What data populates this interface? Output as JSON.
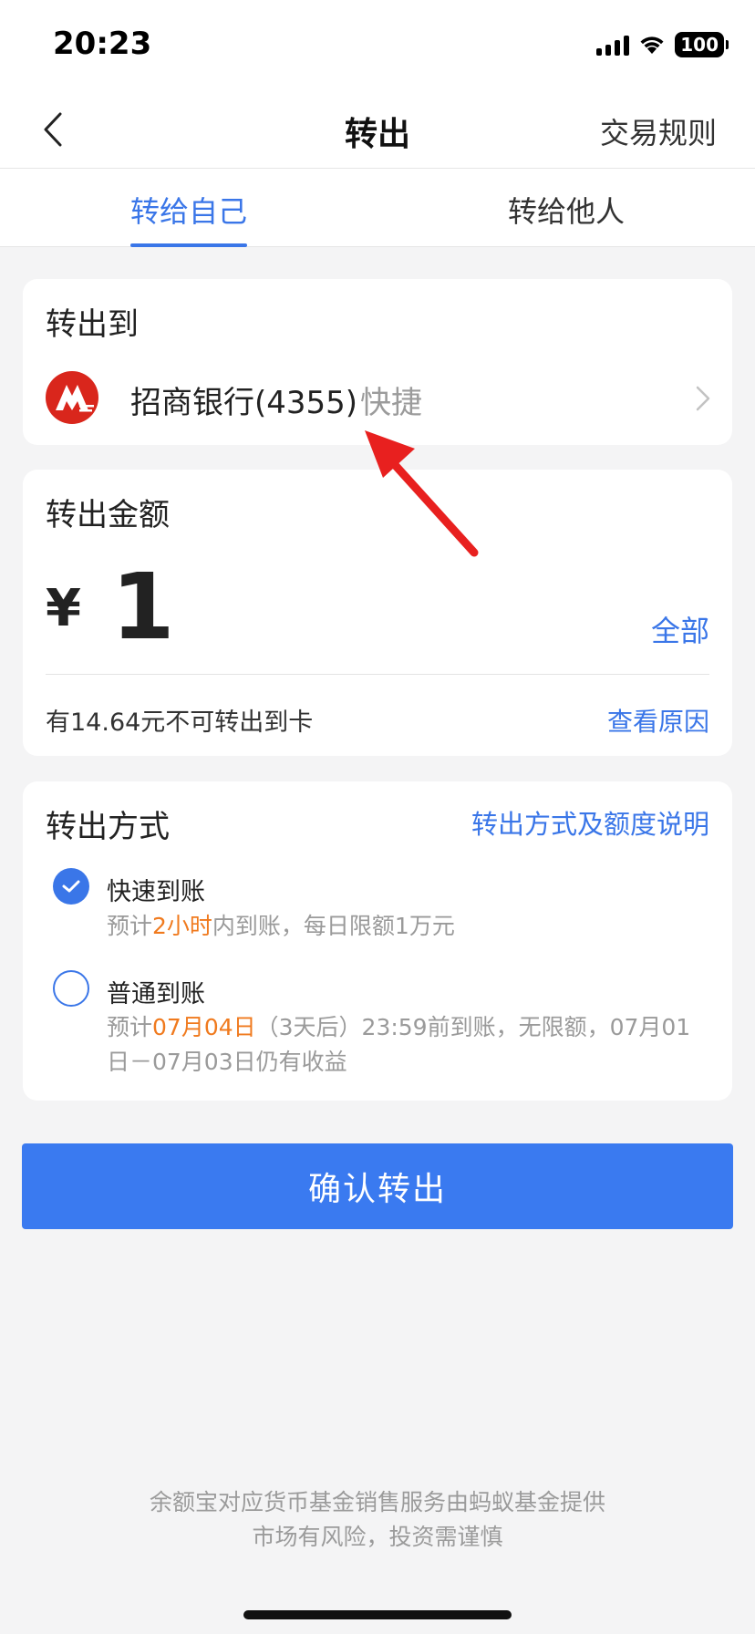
{
  "status_bar": {
    "time": "20:23",
    "battery": "100"
  },
  "nav": {
    "title": "转出",
    "rules_label": "交易规则"
  },
  "tabs": [
    {
      "label": "转给自己",
      "active": true
    },
    {
      "label": "转给他人",
      "active": false
    }
  ],
  "destination": {
    "title": "转出到",
    "bank_name": "招商银行(4355)",
    "bank_tag": "快捷"
  },
  "amount": {
    "title": "转出金额",
    "currency": "¥",
    "value": "1",
    "all_label": "全部",
    "note": "有14.64元不可转出到卡",
    "reason_label": "查看原因"
  },
  "method": {
    "title": "转出方式",
    "info_label": "转出方式及额度说明",
    "options": [
      {
        "title": "快速到账",
        "checked": true,
        "desc_prefix": "预计",
        "desc_highlight": "2小时",
        "desc_suffix": "内到账，每日限额1万元"
      },
      {
        "title": "普通到账",
        "checked": false,
        "desc_prefix": "预计",
        "desc_highlight": "07月04日",
        "desc_suffix": "（3天后）23:59前到账，无限额，07月01日－07月03日仍有收益"
      }
    ]
  },
  "confirm_label": "确认转出",
  "footer": {
    "line1": "余额宝对应货币基金销售服务由蚂蚁基金提供",
    "line2": "市场有风险，投资需谨慎"
  },
  "colors": {
    "accent": "#3a76e8",
    "highlight": "#f07a1e",
    "bank_logo": "#d9261c",
    "annotation_arrow": "#e8201f"
  },
  "icons": {
    "back": "chevron-left-icon",
    "bank": "cmb-bank-logo-icon",
    "chevron": "chevron-right-icon",
    "check": "check-icon"
  }
}
